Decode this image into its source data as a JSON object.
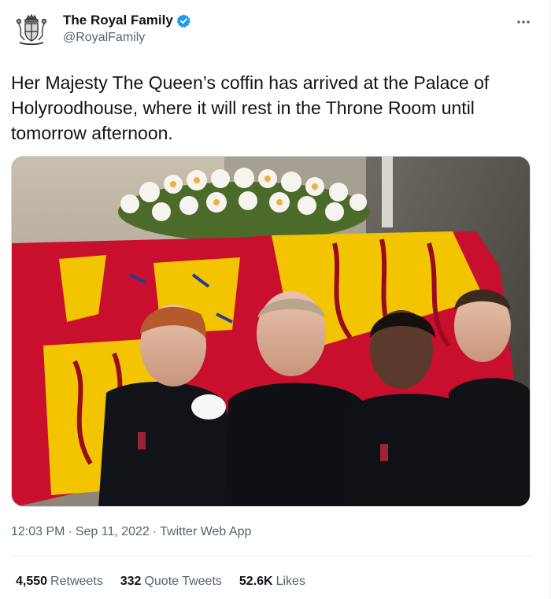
{
  "author": {
    "display_name": "The Royal Family",
    "handle": "@RoyalFamily",
    "verified": true
  },
  "tweet": {
    "text": "Her Majesty The Queen’s coffin has arrived at the Palace of Holyroodhouse, where it will rest in the Throne Room until tomorrow afternoon."
  },
  "meta": {
    "time": "12:03 PM",
    "date": "Sep 11, 2022",
    "source": "Twitter Web App",
    "separator": "·"
  },
  "stats": {
    "retweets": {
      "count": "4,550",
      "label": "Retweets"
    },
    "quote_tweets": {
      "count": "332",
      "label": "Quote Tweets"
    },
    "likes": {
      "count": "52.6K",
      "label": "Likes"
    }
  },
  "colors": {
    "verified_badge": "#1d9bf0",
    "secondary_text": "#536471",
    "royal_standard_red": "#c8102e",
    "royal_standard_gold": "#f2c500"
  },
  "icons": {
    "avatar": "royal-crest-icon",
    "verified": "verified-badge-icon",
    "more": "more-options-icon"
  }
}
